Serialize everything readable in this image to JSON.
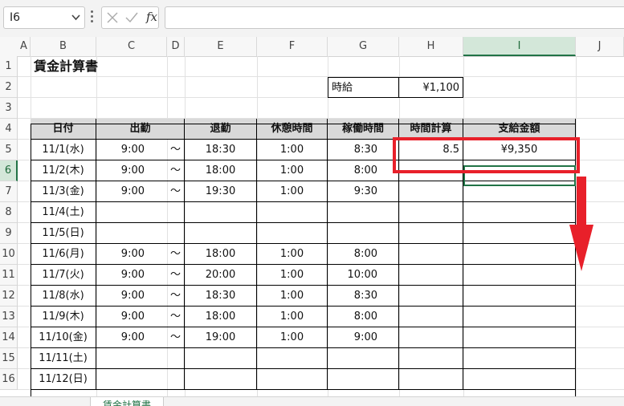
{
  "formula_bar": {
    "name_box": "I6",
    "formula": ""
  },
  "columns": [
    "A",
    "B",
    "C",
    "D",
    "E",
    "F",
    "G",
    "H",
    "I",
    "J"
  ],
  "rows": [
    "1",
    "2",
    "3",
    "4",
    "5",
    "6",
    "7",
    "8",
    "9",
    "10",
    "11",
    "12",
    "13",
    "14",
    "15",
    "16"
  ],
  "selected": {
    "column": "I",
    "row": "6"
  },
  "sheet": {
    "title": "賃金計算書",
    "wage_label": "時給",
    "wage_value": "¥1,100",
    "headers": {
      "date": "日付",
      "start": "出勤",
      "end": "退勤",
      "break": "休憩時間",
      "work": "稼働時間",
      "hours_calc": "時間計算",
      "payment": "支給金額"
    },
    "data_rows": [
      {
        "date": "11/1(水)",
        "start": "9:00",
        "sep": "～",
        "end": "18:30",
        "break": "1:00",
        "work": "8:30",
        "hours": "8.5",
        "pay": "¥9,350"
      },
      {
        "date": "11/2(木)",
        "start": "9:00",
        "sep": "～",
        "end": "18:00",
        "break": "1:00",
        "work": "8:00",
        "hours": "",
        "pay": ""
      },
      {
        "date": "11/3(金)",
        "start": "9:00",
        "sep": "～",
        "end": "19:30",
        "break": "1:00",
        "work": "9:30",
        "hours": "",
        "pay": ""
      },
      {
        "date": "11/4(土)",
        "start": "",
        "sep": "",
        "end": "",
        "break": "",
        "work": "",
        "hours": "",
        "pay": ""
      },
      {
        "date": "11/5(日)",
        "start": "",
        "sep": "",
        "end": "",
        "break": "",
        "work": "",
        "hours": "",
        "pay": ""
      },
      {
        "date": "11/6(月)",
        "start": "9:00",
        "sep": "～",
        "end": "18:00",
        "break": "1:00",
        "work": "8:00",
        "hours": "",
        "pay": ""
      },
      {
        "date": "11/7(火)",
        "start": "9:00",
        "sep": "～",
        "end": "20:00",
        "break": "1:00",
        "work": "10:00",
        "hours": "",
        "pay": ""
      },
      {
        "date": "11/8(水)",
        "start": "9:00",
        "sep": "～",
        "end": "18:30",
        "break": "1:00",
        "work": "8:30",
        "hours": "",
        "pay": ""
      },
      {
        "date": "11/9(木)",
        "start": "9:00",
        "sep": "～",
        "end": "18:00",
        "break": "1:00",
        "work": "8:00",
        "hours": "",
        "pay": ""
      },
      {
        "date": "11/10(金)",
        "start": "9:00",
        "sep": "～",
        "end": "19:00",
        "break": "1:00",
        "work": "9:00",
        "hours": "",
        "pay": ""
      },
      {
        "date": "11/11(土)",
        "start": "",
        "sep": "",
        "end": "",
        "break": "",
        "work": "",
        "hours": "",
        "pay": ""
      },
      {
        "date": "11/12(日)",
        "start": "",
        "sep": "",
        "end": "",
        "break": "",
        "work": "",
        "hours": "",
        "pay": ""
      }
    ]
  },
  "tabs": [
    "賃金計算書"
  ],
  "colors": {
    "accent": "#217346",
    "highlight": "#e8202a",
    "header_fill": "#d9d9d9"
  },
  "icons": [
    "chevron-down-icon",
    "cancel-x-icon",
    "check-icon",
    "function-icon",
    "down-arrow-icon"
  ]
}
